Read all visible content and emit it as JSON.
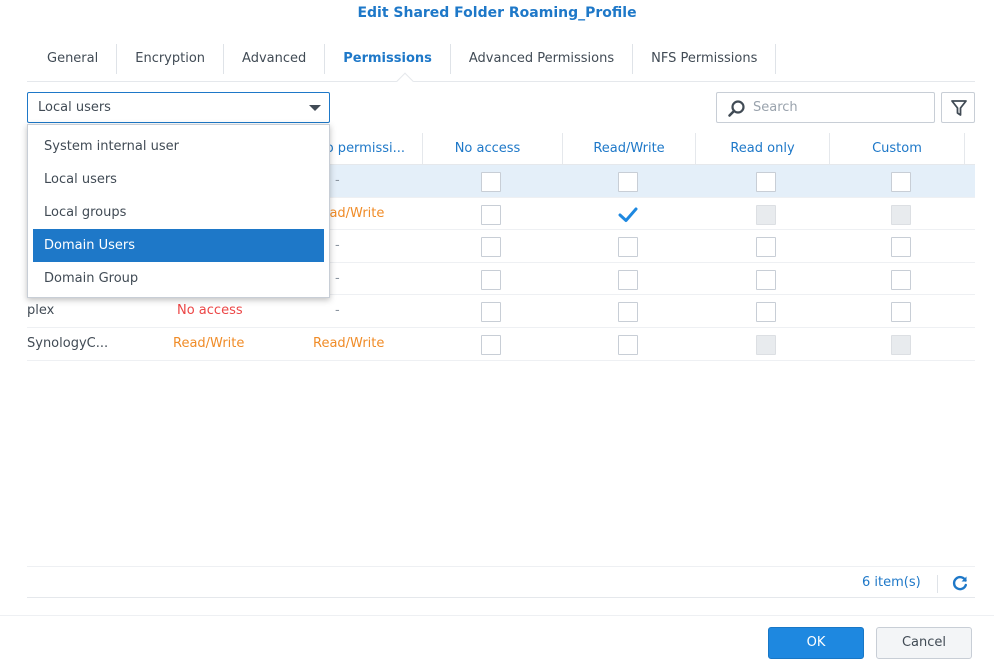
{
  "dialog": {
    "title": "Edit Shared Folder Roaming_Profile"
  },
  "tabs": [
    {
      "label": "General"
    },
    {
      "label": "Encryption"
    },
    {
      "label": "Advanced"
    },
    {
      "label": "Permissions",
      "active": true
    },
    {
      "label": "Advanced Permissions"
    },
    {
      "label": "NFS Permissions"
    }
  ],
  "user_type_select": {
    "value": "Local users",
    "options": [
      "System internal user",
      "Local users",
      "Local groups",
      "Domain Users",
      "Domain Group"
    ],
    "highlighted": "Domain Users"
  },
  "search": {
    "placeholder": "Search"
  },
  "columns": {
    "share": "No permissi...",
    "no_access": "No access",
    "read_write": "Read/Write",
    "read_only": "Read only",
    "custom": "Custom"
  },
  "rows": [
    {
      "name": "",
      "preview": "",
      "share": "-",
      "no_access": false,
      "read_write": false,
      "read_only": false,
      "custom": false,
      "selected": true,
      "disabled": false
    },
    {
      "name": "",
      "preview": "",
      "share": "Read/Write",
      "no_access": false,
      "read_write": true,
      "read_only": false,
      "custom": false,
      "selected": false,
      "disabled": true
    },
    {
      "name": "",
      "preview": "",
      "share": "-",
      "no_access": false,
      "read_write": false,
      "read_only": false,
      "custom": false,
      "selected": false,
      "disabled": false
    },
    {
      "name": "",
      "preview": "",
      "share": "-",
      "no_access": false,
      "read_write": false,
      "read_only": false,
      "custom": false,
      "selected": false,
      "disabled": false
    },
    {
      "name": "plex",
      "preview": "No access",
      "share": "-",
      "no_access": false,
      "read_write": false,
      "read_only": false,
      "custom": false,
      "selected": false,
      "disabled": false
    },
    {
      "name": "SynologyC...",
      "preview": "Read/Write",
      "share": "Read/Write",
      "no_access": false,
      "read_write": false,
      "read_only": false,
      "custom": false,
      "selected": false,
      "disabled": true
    }
  ],
  "footer": {
    "count": "6 item(s)"
  },
  "buttons": {
    "ok": "OK",
    "cancel": "Cancel"
  },
  "colors": {
    "accent": "#1e78c8",
    "no_access": "#ec4646",
    "read_write": "#f08c28",
    "selected_row": "#e4eff9"
  }
}
